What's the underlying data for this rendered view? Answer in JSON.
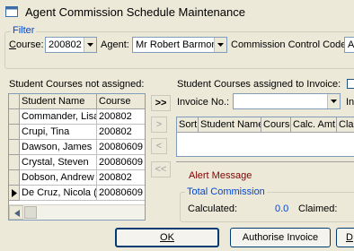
{
  "window": {
    "title": "Agent Commission Schedule Maintenance"
  },
  "filter": {
    "legend": "Filter",
    "course_label": "Course:",
    "course_value": "200802",
    "agent_label": "Agent:",
    "agent_value": "Mr Robert Barmon",
    "control_code_label": "Commission Control Code:",
    "control_code_value": "A"
  },
  "unassigned": {
    "label": "Student Courses not assigned:",
    "columns": [
      "Student Name",
      "Course"
    ],
    "rows": [
      {
        "name": "Commander, Lisa",
        "course": "200802"
      },
      {
        "name": "Crupi, Tina",
        "course": "200802"
      },
      {
        "name": "Dawson, James",
        "course": "20080609"
      },
      {
        "name": "Crystal, Steven",
        "course": "20080609"
      },
      {
        "name": "Dobson, Andrew",
        "course": "200802"
      },
      {
        "name": "De Cruz, Nicola (",
        "course": "20080609"
      }
    ],
    "current_row_index": 5
  },
  "move_buttons": {
    "assign_all": ">>",
    "assign_one": ">",
    "unassign_one": "<",
    "unassign_all": "<<"
  },
  "assigned": {
    "label": "Student Courses assigned to Invoice:",
    "invoice_label": "Invoice No.:",
    "invoice_value": "",
    "right_cut_label": "In",
    "columns": [
      "Sort",
      "Student Name",
      "Course",
      "Calc. Amt",
      "Clai"
    ]
  },
  "alert": {
    "text": "Alert Message",
    "color": "#800000"
  },
  "total_commission": {
    "legend": "Total Commission",
    "calculated_label": "Calculated:",
    "calculated_value": "0.0",
    "claimed_label": "Claimed:"
  },
  "buttons": {
    "ok": "OK",
    "authorise": "Authorise Invoice",
    "cut": "D"
  },
  "colors": {
    "accent": "#0046d5",
    "value_blue": "#0046d5"
  }
}
